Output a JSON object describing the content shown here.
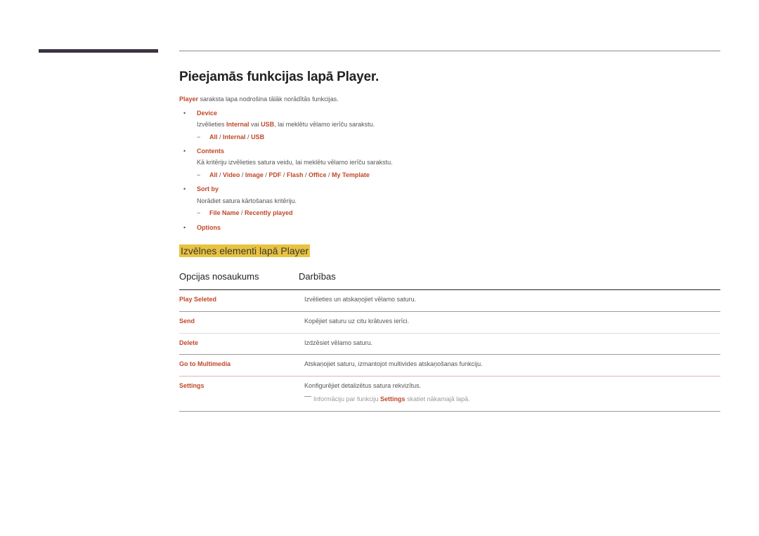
{
  "page": {
    "title": "Pieejamās funkcijas lapā Player.",
    "intro": {
      "highlight": "Player",
      "text": " saraksta lapa nodrošina tālāk norādītās funkcijas."
    },
    "bullets": [
      {
        "label": "Device",
        "desc_parts": [
          {
            "t": "Izvēlieties ",
            "h": false
          },
          {
            "t": "Internal",
            "h": true
          },
          {
            "t": " vai ",
            "h": false
          },
          {
            "t": "USB",
            "h": true
          },
          {
            "t": ", lai meklētu vēlamo ierīču sarakstu.",
            "h": false
          }
        ],
        "options": [
          "All",
          "Internal",
          "USB"
        ]
      },
      {
        "label": "Contents",
        "desc_parts": [
          {
            "t": "Kā kritēriju izvēlieties satura veidu, lai meklētu vēlamo ierīču sarakstu.",
            "h": false
          }
        ],
        "options": [
          "All",
          "Video",
          "Image",
          "PDF",
          "Flash",
          "Office",
          "My Template"
        ]
      },
      {
        "label": "Sort by",
        "desc_parts": [
          {
            "t": "Norādiet satura kārtošanas kritēriju.",
            "h": false
          }
        ],
        "options": [
          "File Name",
          "Recently played"
        ]
      },
      {
        "label": "Options",
        "desc_parts": [],
        "options": []
      }
    ],
    "bullet_glyph": "•",
    "dash_glyph": "−",
    "option_separator": " / "
  },
  "section": {
    "heading": "Izvēlnes elementi lapā Player",
    "table": {
      "headers": [
        "Opcijas nosaukums",
        "Darbības"
      ],
      "rows": [
        {
          "name": "Play Seleted",
          "desc": "Izvēlieties un atskaņojiet vēlamo saturu."
        },
        {
          "name": "Send",
          "desc": "Kopējiet saturu uz citu krātuves ierīci."
        },
        {
          "name": "Delete",
          "desc": "Izdzēsiet vēlamo saturu."
        },
        {
          "name": "Go to Multimedia",
          "desc": "Atskaņojiet saturu, izmantojot multivides atskaņošanas funkciju."
        },
        {
          "name": "Settings",
          "desc": "Konfigurējiet detalizētus satura rekvizītus.",
          "note": {
            "before": "Informāciju par funkciju ",
            "highlight": "Settings",
            "after": " skatiet nākamajā lapā."
          }
        }
      ]
    }
  },
  "colors": {
    "accent": "#c0482a",
    "heading_highlight": "#e9c23f",
    "side_bar": "#3b3342"
  }
}
